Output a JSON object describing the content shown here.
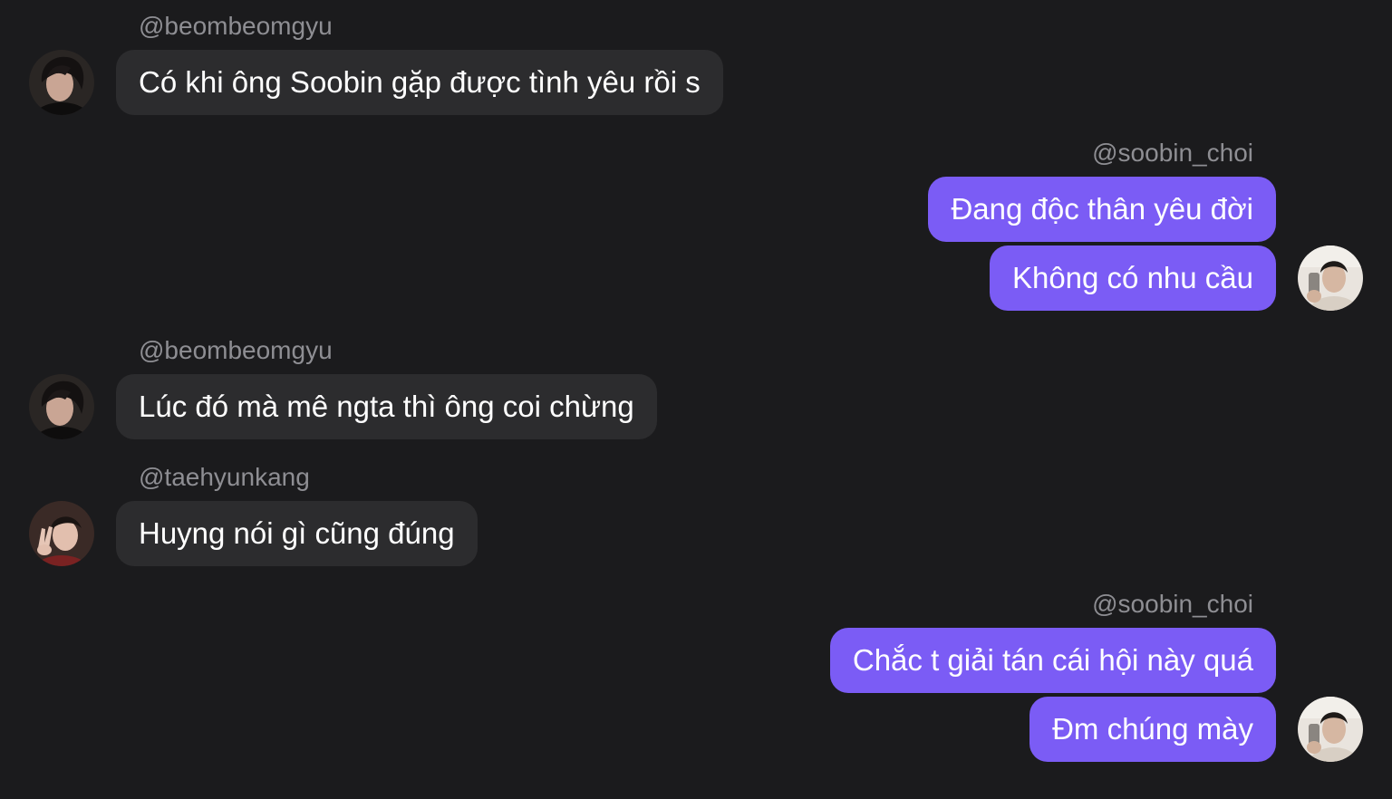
{
  "messages": [
    {
      "sender": "@beombeomgyu",
      "text": "Có khi ông Soobin gặp được tình yêu rồi s"
    },
    {
      "sender": "@soobin_choi",
      "texts": [
        "Đang độc thân yêu đời",
        "Không có nhu cầu"
      ]
    },
    {
      "sender": "@beombeomgyu",
      "text": "Lúc đó mà mê ngta thì ông coi chừng"
    },
    {
      "sender": "@taehyunkang",
      "text": "Huyng nói gì cũng đúng"
    },
    {
      "sender": "@soobin_choi",
      "texts": [
        "Chắc t giải tán cái hội này quá",
        "Đm chúng mày"
      ]
    }
  ],
  "colors": {
    "background": "#1b1b1d",
    "incoming_bubble": "#2c2c2e",
    "outgoing_bubble": "#7b5cf5",
    "username": "#8e8e93"
  }
}
